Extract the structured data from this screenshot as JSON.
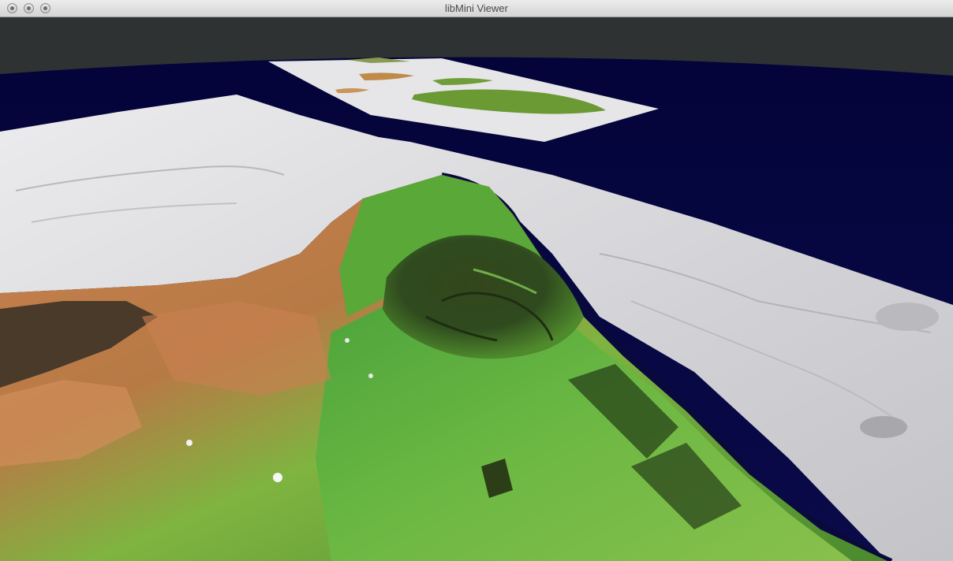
{
  "window": {
    "title": "libMini Viewer",
    "buttons": [
      {
        "name": "close",
        "icon": "close-dot-icon"
      },
      {
        "name": "minimize",
        "icon": "minimize-dot-icon"
      },
      {
        "name": "zoom",
        "icon": "zoom-dot-icon"
      }
    ]
  },
  "colors": {
    "sky": "#2e3233",
    "ocean": "#05053a",
    "seafloor": "#d8d8da",
    "vegetation": "#5da83a",
    "arid": "#c77f4e",
    "forest": "#2f4a1e"
  }
}
